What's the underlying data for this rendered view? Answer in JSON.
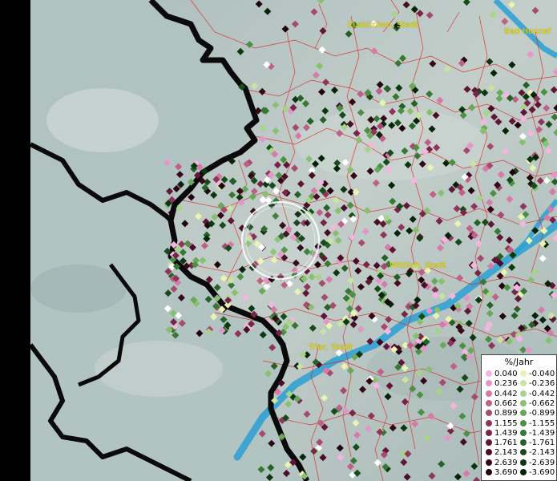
{
  "map": {
    "places": [
      {
        "name": "Euskirchen, Stadt"
      },
      {
        "name": "Bad Honnef"
      },
      {
        "name": "Wittlich, Stadt"
      },
      {
        "name": "Trier, Stadt"
      }
    ]
  },
  "legend": {
    "title": "%/Jahr",
    "positive": [
      {
        "label": "0.040",
        "color": "#f4b6e0"
      },
      {
        "label": "0.236",
        "color": "#e496c8"
      },
      {
        "label": "0.442",
        "color": "#d77aa8"
      },
      {
        "label": "0.662",
        "color": "#c06089"
      },
      {
        "label": "0.899",
        "color": "#a8496f"
      },
      {
        "label": "1.155",
        "color": "#90355a"
      },
      {
        "label": "1.439",
        "color": "#782547"
      },
      {
        "label": "1.761",
        "color": "#601735"
      },
      {
        "label": "2.143",
        "color": "#4a0d25"
      },
      {
        "label": "2.639",
        "color": "#360717"
      },
      {
        "label": "3.690",
        "color": "#20030c"
      }
    ],
    "negative": [
      {
        "label": "-0.040",
        "color": "#e8f4b0"
      },
      {
        "label": "-0.236",
        "color": "#c8e4a0"
      },
      {
        "label": "-0.442",
        "color": "#a8d488"
      },
      {
        "label": "-0.662",
        "color": "#88c070"
      },
      {
        "label": "-0.899",
        "color": "#68a858"
      },
      {
        "label": "-1.155",
        "color": "#4c9044"
      },
      {
        "label": "-1.439",
        "color": "#367834"
      },
      {
        "label": "-1.761",
        "color": "#246226"
      },
      {
        "label": "-2.143",
        "color": "#164c1a"
      },
      {
        "label": "-2.639",
        "color": "#0c3810"
      },
      {
        "label": "-3.690",
        "color": "#052408"
      }
    ]
  }
}
